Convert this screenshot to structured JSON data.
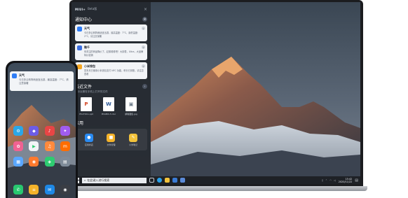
{
  "panel": {
    "brand": "MIUI+",
    "brand_sub": "Beta版",
    "notifications_title": "通知中心",
    "notifications": [
      {
        "title": "天气",
        "body": "今日多云转阵雨适宜出游，最高温度：7°C，最低温度：2°C，请注意保暖",
        "color": "#2f7df6",
        "icon": "weather-icon"
      },
      {
        "title": "微千",
        "body": "你关注的商品降价了，赶紧看看吧！大钟表，Ultra，大品牌特价促销",
        "color": "#3c6fe0",
        "icon": "message-icon"
      },
      {
        "title": "小米钱包",
        "body": "您本月已使用小米钱包支付 NFC 功能，积分已到账，请注意查看",
        "color": "#f5a623",
        "icon": "wallet-icon"
      }
    ],
    "files_title": "最近文件",
    "files_sub": "显示近期在手机上打开的文件",
    "files": [
      {
        "name": "PhoTOCo.ppt",
        "letter": "P",
        "color": "#d24726"
      },
      {
        "name": "PDABIC-5.doc",
        "letter": "W",
        "color": "#2b5797"
      },
      {
        "name": "邮箱图集.jpg",
        "letter": "▣",
        "color": "#6d7a88"
      }
    ],
    "apps_title": "应用",
    "apps": [
      {
        "name": "应用商店",
        "color": "#2a8bf2",
        "glyph": "●"
      },
      {
        "name": "文件管理",
        "color": "#f4b32a",
        "glyph": "■"
      },
      {
        "name": "小米笔记",
        "color": "#f2c23b",
        "glyph": "✎"
      }
    ]
  },
  "taskbar": {
    "search_placeholder": "在此键入进行搜索",
    "time": "15:42",
    "date": "2020/11/22"
  },
  "phone": {
    "notification": {
      "title": "天气",
      "body": "今日多云转阵雨适宜出游，最高温度：7°C，请注意保暖"
    },
    "apps": [
      {
        "icon": "settings-icon",
        "color": "#2aa7e8"
      },
      {
        "icon": "gallery-icon",
        "color": "#6c5ce7"
      },
      {
        "icon": "video-icon",
        "color": "#e84545"
      },
      {
        "icon": "theme-icon",
        "color": "#a05cf0"
      },
      {
        "icon": "photos-icon",
        "color": "#f06292"
      },
      {
        "icon": "play-store-icon",
        "color": "#f2f4f7"
      },
      {
        "icon": "music-icon",
        "color": "#ff8a3d"
      },
      {
        "icon": "mi-store-icon",
        "color": "#ff6d00"
      },
      {
        "icon": "calendar-icon",
        "color": "#5aa7ff"
      },
      {
        "icon": "app-store-icon",
        "color": "#ff7a2e"
      },
      {
        "icon": "security-icon",
        "color": "#2ecc71"
      },
      {
        "icon": "tools-icon",
        "color": "#7f8c9a"
      }
    ],
    "dock": [
      {
        "icon": "phone-icon",
        "color": "#28c76f"
      },
      {
        "icon": "notes-icon",
        "color": "#f4b32a"
      },
      {
        "icon": "messages-icon",
        "color": "#1e88e5"
      },
      {
        "icon": "camera-icon",
        "color": "#3a3d44"
      }
    ]
  }
}
